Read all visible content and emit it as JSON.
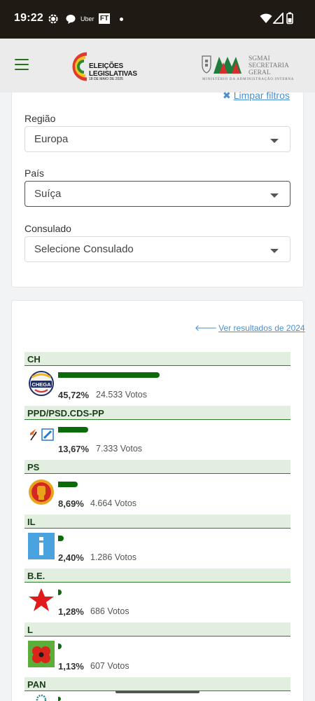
{
  "status_bar": {
    "time": "19:22",
    "uber_label": "Uber",
    "ft_label": "FT"
  },
  "header": {
    "elections_logo_line1": "ELEIÇÕES",
    "elections_logo_line2": "LEGISLATIVAS",
    "elections_logo_date": "18 DE MAIO DE 2025",
    "sgmai_line1": "SGMAI",
    "sgmai_line2": "SECRETARIA",
    "sgmai_line3": "GERAL",
    "sgmai_subtitle": "MINISTÉRIO DA ADMINISTRAÇÃO INTERNA"
  },
  "filters": {
    "clear_label": "Limpar filtros",
    "region_label": "Região",
    "region_value": "Europa",
    "country_label": "País",
    "country_value": "Suíça",
    "consulate_label": "Consulado",
    "consulate_value": "Selecione Consulado"
  },
  "results": {
    "previous_link": "Ver resultados de 2024",
    "parties": [
      {
        "name": "CH",
        "percent": "45,72%",
        "votes": "24.533 Votos",
        "share": 45.72
      },
      {
        "name": "PPD/PSD.CDS-PP",
        "percent": "13,67%",
        "votes": "7.333 Votos",
        "share": 13.67
      },
      {
        "name": "PS",
        "percent": "8,69%",
        "votes": "4.664 Votos",
        "share": 8.69
      },
      {
        "name": "IL",
        "percent": "2,40%",
        "votes": "1.286 Votos",
        "share": 2.4
      },
      {
        "name": "B.E.",
        "percent": "1,28%",
        "votes": "686 Votos",
        "share": 1.28
      },
      {
        "name": "L",
        "percent": "1,13%",
        "votes": "607 Votos",
        "share": 1.13
      },
      {
        "name": "PAN",
        "percent": "",
        "votes": "",
        "share": null
      }
    ]
  },
  "colors": {
    "accent_green": "#0b6b0b",
    "link_blue": "#4a8fd0",
    "header_bg": "#ebebeb",
    "status_bg": "#201a15"
  }
}
